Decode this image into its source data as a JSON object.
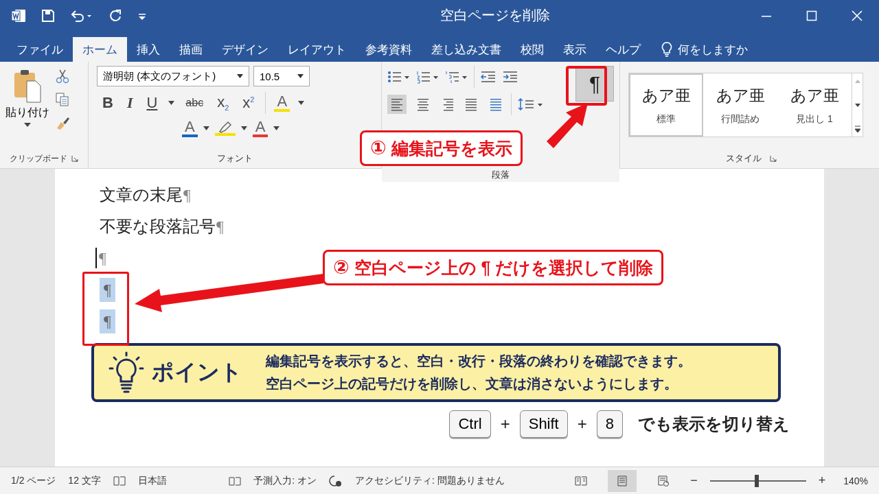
{
  "window": {
    "title": "空白ページを削除"
  },
  "tabs": [
    {
      "label": "ファイル",
      "selected": false
    },
    {
      "label": "ホーム",
      "selected": true
    },
    {
      "label": "挿入",
      "selected": false
    },
    {
      "label": "描画",
      "selected": false
    },
    {
      "label": "デザイン",
      "selected": false
    },
    {
      "label": "レイアウト",
      "selected": false
    },
    {
      "label": "参考資料",
      "selected": false
    },
    {
      "label": "差し込み文書",
      "selected": false
    },
    {
      "label": "校閲",
      "selected": false
    },
    {
      "label": "表示",
      "selected": false
    },
    {
      "label": "ヘルプ",
      "selected": false
    }
  ],
  "tell_me": "何をしますか",
  "clipboard": {
    "paste_label": "貼り付け",
    "group_label": "クリップボード"
  },
  "font": {
    "font_name": "游明朝 (本文のフォント)",
    "font_size": "10.5",
    "group_label": "フォント",
    "format_buttons": [
      {
        "kind": "bold",
        "label": "B"
      },
      {
        "kind": "italic",
        "label": "I"
      },
      {
        "kind": "underline",
        "label": "U"
      },
      {
        "kind": "strike",
        "label": "abc"
      },
      {
        "kind": "sub",
        "label": "x$_{2}$"
      },
      {
        "kind": "sup",
        "label": "x$^{2}$"
      }
    ],
    "color_buttons": [
      {
        "kind": "effect",
        "label": "A",
        "color": "#f5e100"
      },
      {
        "kind": "font_color",
        "label": "A",
        "color": "#1565c0"
      },
      {
        "kind": "highlight",
        "color": "#f5e100"
      },
      {
        "kind": "font_color",
        "label": "A",
        "color": "#e53935"
      }
    ]
  },
  "paragraph": {
    "group_label": "段落",
    "show_marks": {
      "label": "¶",
      "on": true
    },
    "alignments": [
      {
        "kind": "left",
        "selected": true
      },
      {
        "kind": "center",
        "selected": false
      },
      {
        "kind": "right",
        "selected": false
      },
      {
        "kind": "justify",
        "selected": false
      },
      {
        "kind": "distributed",
        "selected": false
      }
    ]
  },
  "styles": {
    "group_label": "スタイル",
    "items": [
      {
        "sample": "あア亜",
        "name": "標準",
        "selected": true
      },
      {
        "sample": "あア亜",
        "name": "行間詰め",
        "selected": false
      },
      {
        "sample": "あア亜",
        "name": "見出し 1",
        "selected": false
      }
    ]
  },
  "document": {
    "lines": [
      {
        "text": "文章の末尾",
        "mark": "¶",
        "selected": false,
        "cursor": false
      },
      {
        "text": "不要な段落記号",
        "mark": "¶",
        "selected": false,
        "cursor": false
      },
      {
        "mark": "¶",
        "selected": false,
        "cursor": true
      },
      {
        "mark": "¶",
        "selected": true,
        "cursor": false
      },
      {
        "mark": "¶",
        "selected": true,
        "cursor": false
      }
    ]
  },
  "callouts": [
    {
      "number": "①",
      "text": "編集記号を表示"
    },
    {
      "number": "②",
      "text": "空白ページ上の ¶ だけを選択して削除"
    }
  ],
  "point": {
    "title": "ポイント",
    "lines": [
      "編集記号を表示すると、空白・改行・段落の終わりを確認できます。",
      "空白ページ上の記号だけを削除し、文章は消さないようにします。"
    ]
  },
  "shortcut": {
    "items": [
      {
        "kind": "key",
        "label": "Ctrl"
      },
      {
        "kind": "plus",
        "label": "+"
      },
      {
        "kind": "key",
        "label": "Shift"
      },
      {
        "kind": "plus",
        "label": "+"
      },
      {
        "kind": "key",
        "label": "8"
      }
    ],
    "suffix": "でも表示を切り替え"
  },
  "status_bar": {
    "page": "1/2 ページ",
    "words": "12 文字",
    "language": "日本語",
    "predictive": "予測入力: オン",
    "accessibility": "アクセシビリティ: 問題ありません",
    "views": [
      {
        "kind": "read",
        "selected": false
      },
      {
        "kind": "print",
        "selected": true
      },
      {
        "kind": "web",
        "selected": false
      }
    ],
    "zoom_minus": "−",
    "zoom_plus": "+",
    "zoom": {
      "level": 0.49,
      "label": "140%"
    }
  }
}
